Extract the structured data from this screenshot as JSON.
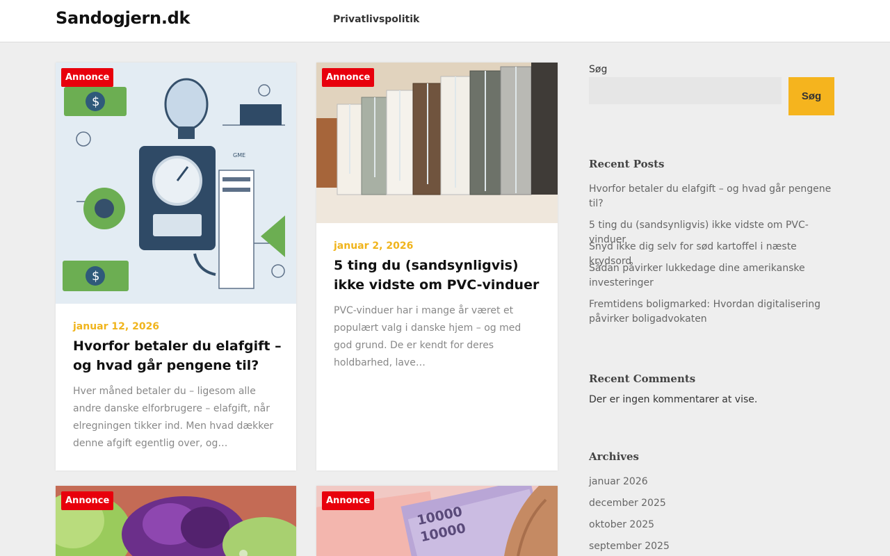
{
  "header": {
    "site_title": "Sandogjern.dk",
    "nav": [
      "Privatlivspolitik"
    ]
  },
  "posts": [
    {
      "badge": "Annonce",
      "date": "januar 12, 2026",
      "title": "Hvorfor betaler du elafgift – og hvad går pengene til?",
      "excerpt": "Hver måned betaler du – ligesom alle andre danske elforbrugere – elafgift, når elregningen tikker ind. Men hvad dækker denne afgift egentlig over, og…",
      "image_label": "GME"
    },
    {
      "badge": "Annonce",
      "date": "januar 2, 2026",
      "title": "5 ting du (sandsynligvis) ikke vidste om PVC-vinduer",
      "excerpt": "PVC-vinduer har i mange år været et populært valg i danske hjem – og med god grund. De er kendt for deres holdbarhed, lave…"
    },
    {
      "badge": "Annonce"
    },
    {
      "badge": "Annonce",
      "image_label": "10000"
    }
  ],
  "sidebar": {
    "search_label": "Søg",
    "search_placeholder": "",
    "search_button": "Søg",
    "recent_posts_title": "Recent Posts",
    "recent_posts": [
      "Hvorfor betaler du elafgift – og hvad går pengene til?",
      "5 ting du (sandsynligvis) ikke vidste om PVC-vinduer",
      "Snyd ikke dig selv for sød kartoffel i næste krydsord",
      "Sådan påvirker lukkedage dine amerikanske investeringer",
      "Fremtidens boligmarked: Hvordan digitalisering påvirker boligadvokaten"
    ],
    "recent_comments_title": "Recent Comments",
    "recent_comments_text": "Der er ingen kommentarer at vise.",
    "archives_title": "Archives",
    "archives": [
      "januar 2026",
      "december 2025",
      "oktober 2025",
      "september 2025"
    ]
  },
  "colors": {
    "accent_yellow": "#f5b41e",
    "badge_red": "#e8000c",
    "background": "#eeeeee"
  }
}
